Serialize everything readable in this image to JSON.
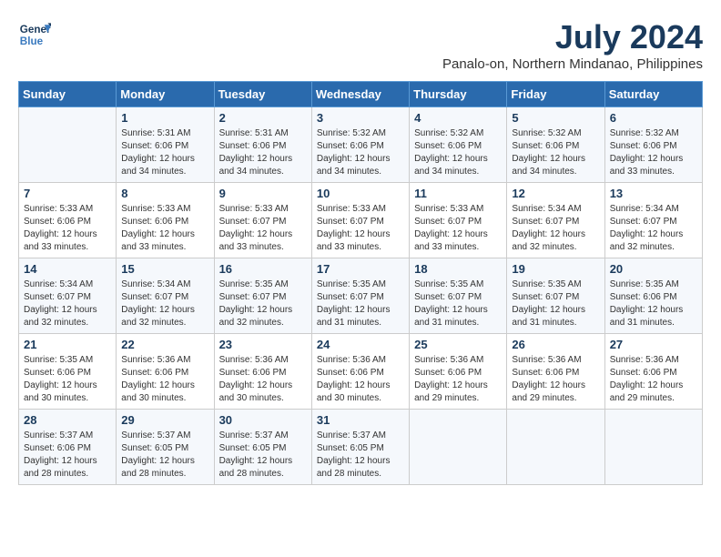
{
  "logo": {
    "line1": "General",
    "line2": "Blue"
  },
  "title": {
    "month_year": "July 2024",
    "location": "Panalo-on, Northern Mindanao, Philippines"
  },
  "header": {
    "days": [
      "Sunday",
      "Monday",
      "Tuesday",
      "Wednesday",
      "Thursday",
      "Friday",
      "Saturday"
    ]
  },
  "weeks": [
    [
      {
        "day": "",
        "info": ""
      },
      {
        "day": "1",
        "info": "Sunrise: 5:31 AM\nSunset: 6:06 PM\nDaylight: 12 hours\nand 34 minutes."
      },
      {
        "day": "2",
        "info": "Sunrise: 5:31 AM\nSunset: 6:06 PM\nDaylight: 12 hours\nand 34 minutes."
      },
      {
        "day": "3",
        "info": "Sunrise: 5:32 AM\nSunset: 6:06 PM\nDaylight: 12 hours\nand 34 minutes."
      },
      {
        "day": "4",
        "info": "Sunrise: 5:32 AM\nSunset: 6:06 PM\nDaylight: 12 hours\nand 34 minutes."
      },
      {
        "day": "5",
        "info": "Sunrise: 5:32 AM\nSunset: 6:06 PM\nDaylight: 12 hours\nand 34 minutes."
      },
      {
        "day": "6",
        "info": "Sunrise: 5:32 AM\nSunset: 6:06 PM\nDaylight: 12 hours\nand 33 minutes."
      }
    ],
    [
      {
        "day": "7",
        "info": "Sunrise: 5:33 AM\nSunset: 6:06 PM\nDaylight: 12 hours\nand 33 minutes."
      },
      {
        "day": "8",
        "info": "Sunrise: 5:33 AM\nSunset: 6:06 PM\nDaylight: 12 hours\nand 33 minutes."
      },
      {
        "day": "9",
        "info": "Sunrise: 5:33 AM\nSunset: 6:07 PM\nDaylight: 12 hours\nand 33 minutes."
      },
      {
        "day": "10",
        "info": "Sunrise: 5:33 AM\nSunset: 6:07 PM\nDaylight: 12 hours\nand 33 minutes."
      },
      {
        "day": "11",
        "info": "Sunrise: 5:33 AM\nSunset: 6:07 PM\nDaylight: 12 hours\nand 33 minutes."
      },
      {
        "day": "12",
        "info": "Sunrise: 5:34 AM\nSunset: 6:07 PM\nDaylight: 12 hours\nand 32 minutes."
      },
      {
        "day": "13",
        "info": "Sunrise: 5:34 AM\nSunset: 6:07 PM\nDaylight: 12 hours\nand 32 minutes."
      }
    ],
    [
      {
        "day": "14",
        "info": "Sunrise: 5:34 AM\nSunset: 6:07 PM\nDaylight: 12 hours\nand 32 minutes."
      },
      {
        "day": "15",
        "info": "Sunrise: 5:34 AM\nSunset: 6:07 PM\nDaylight: 12 hours\nand 32 minutes."
      },
      {
        "day": "16",
        "info": "Sunrise: 5:35 AM\nSunset: 6:07 PM\nDaylight: 12 hours\nand 32 minutes."
      },
      {
        "day": "17",
        "info": "Sunrise: 5:35 AM\nSunset: 6:07 PM\nDaylight: 12 hours\nand 31 minutes."
      },
      {
        "day": "18",
        "info": "Sunrise: 5:35 AM\nSunset: 6:07 PM\nDaylight: 12 hours\nand 31 minutes."
      },
      {
        "day": "19",
        "info": "Sunrise: 5:35 AM\nSunset: 6:07 PM\nDaylight: 12 hours\nand 31 minutes."
      },
      {
        "day": "20",
        "info": "Sunrise: 5:35 AM\nSunset: 6:06 PM\nDaylight: 12 hours\nand 31 minutes."
      }
    ],
    [
      {
        "day": "21",
        "info": "Sunrise: 5:35 AM\nSunset: 6:06 PM\nDaylight: 12 hours\nand 30 minutes."
      },
      {
        "day": "22",
        "info": "Sunrise: 5:36 AM\nSunset: 6:06 PM\nDaylight: 12 hours\nand 30 minutes."
      },
      {
        "day": "23",
        "info": "Sunrise: 5:36 AM\nSunset: 6:06 PM\nDaylight: 12 hours\nand 30 minutes."
      },
      {
        "day": "24",
        "info": "Sunrise: 5:36 AM\nSunset: 6:06 PM\nDaylight: 12 hours\nand 30 minutes."
      },
      {
        "day": "25",
        "info": "Sunrise: 5:36 AM\nSunset: 6:06 PM\nDaylight: 12 hours\nand 29 minutes."
      },
      {
        "day": "26",
        "info": "Sunrise: 5:36 AM\nSunset: 6:06 PM\nDaylight: 12 hours\nand 29 minutes."
      },
      {
        "day": "27",
        "info": "Sunrise: 5:36 AM\nSunset: 6:06 PM\nDaylight: 12 hours\nand 29 minutes."
      }
    ],
    [
      {
        "day": "28",
        "info": "Sunrise: 5:37 AM\nSunset: 6:06 PM\nDaylight: 12 hours\nand 28 minutes."
      },
      {
        "day": "29",
        "info": "Sunrise: 5:37 AM\nSunset: 6:05 PM\nDaylight: 12 hours\nand 28 minutes."
      },
      {
        "day": "30",
        "info": "Sunrise: 5:37 AM\nSunset: 6:05 PM\nDaylight: 12 hours\nand 28 minutes."
      },
      {
        "day": "31",
        "info": "Sunrise: 5:37 AM\nSunset: 6:05 PM\nDaylight: 12 hours\nand 28 minutes."
      },
      {
        "day": "",
        "info": ""
      },
      {
        "day": "",
        "info": ""
      },
      {
        "day": "",
        "info": ""
      }
    ]
  ]
}
